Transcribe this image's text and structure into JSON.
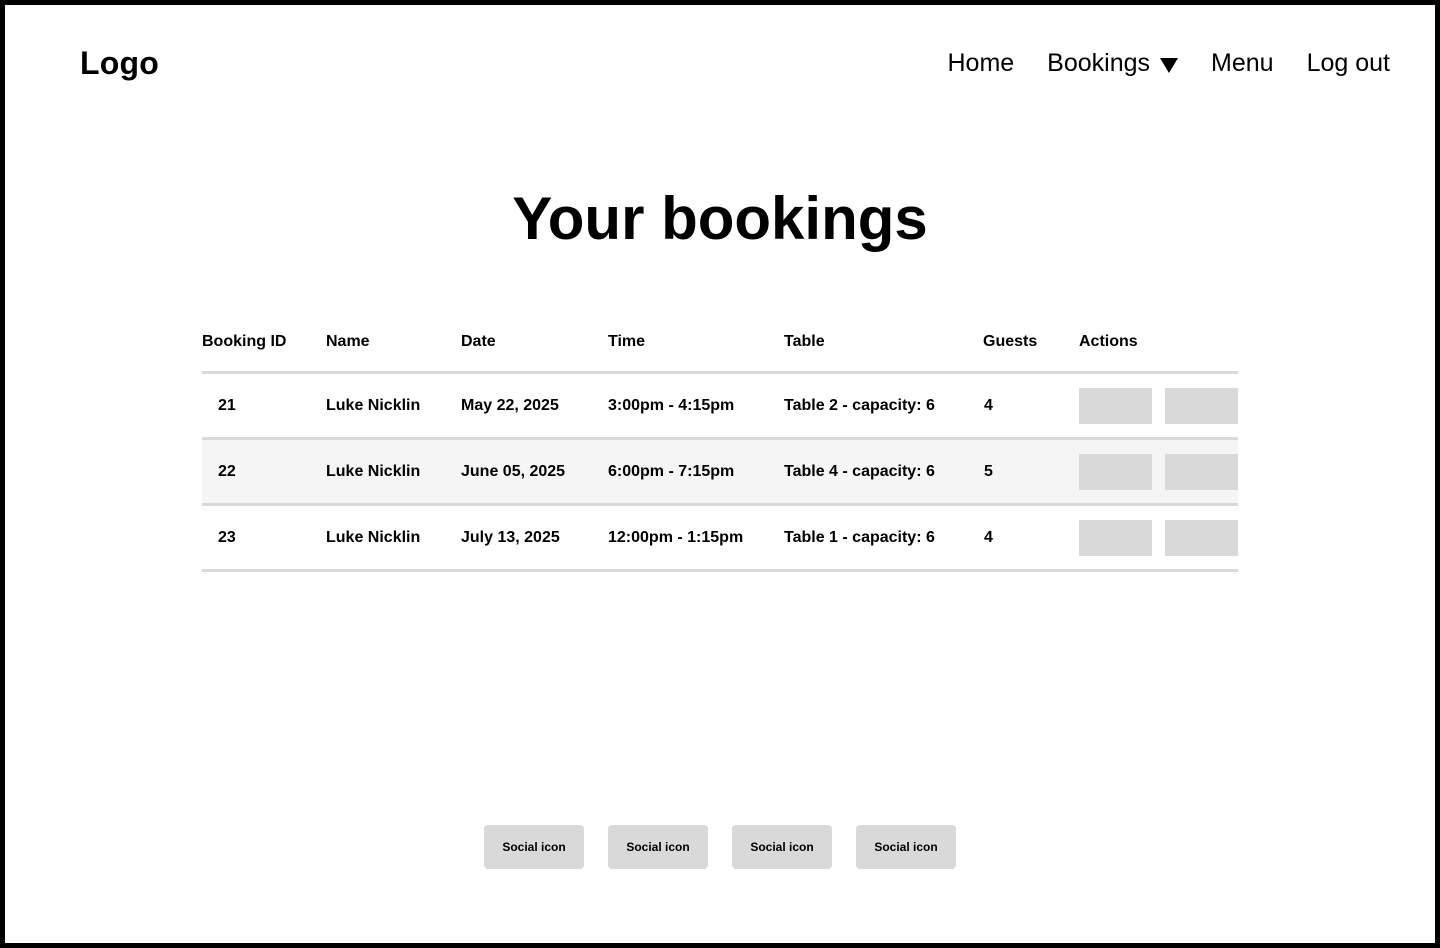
{
  "header": {
    "logo": "Logo",
    "nav": {
      "home": "Home",
      "bookings": "Bookings",
      "menu": "Menu",
      "logout": "Log out"
    }
  },
  "main": {
    "title": "Your bookings",
    "table": {
      "headers": [
        "Booking ID",
        "Name",
        "Date",
        "Time",
        "Table",
        "Guests",
        "Actions"
      ],
      "rows": [
        {
          "id": "21",
          "name": "Luke Nicklin",
          "date": "May 22, 2025",
          "time": "3:00pm - 4:15pm",
          "table": "Table 2 - capacity: 6",
          "guests": "4"
        },
        {
          "id": "22",
          "name": "Luke Nicklin",
          "date": "June 05, 2025",
          "time": "6:00pm - 7:15pm",
          "table": "Table 4 - capacity: 6",
          "guests": "5"
        },
        {
          "id": "23",
          "name": "Luke Nicklin",
          "date": "July 13, 2025",
          "time": "12:00pm - 1:15pm",
          "table": "Table 1 - capacity: 6",
          "guests": "4"
        }
      ]
    }
  },
  "footer": {
    "social": [
      "Social icon",
      "Social icon",
      "Social icon",
      "Social icon"
    ]
  },
  "colors": {
    "border": "#000000",
    "placeholder": "#d9d9d9",
    "row_stripe": "#f5f5f5",
    "divider": "#d9d9d9"
  }
}
